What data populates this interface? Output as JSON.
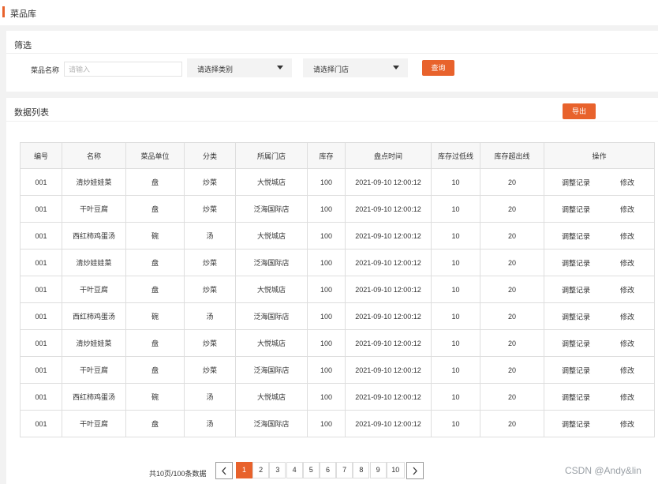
{
  "header": {
    "title": "菜品库"
  },
  "filter": {
    "title": "筛选",
    "name_label": "菜品名称",
    "name_placeholder": "请输入",
    "category_select": "请选择类别",
    "store_select": "请选择门店",
    "query_label": "查询"
  },
  "list": {
    "title": "数据列表",
    "export_label": "导出",
    "columns": [
      "编号",
      "名称",
      "菜品单位",
      "分类",
      "所属门店",
      "库存",
      "盘点时间",
      "库存过低线",
      "库存超出线",
      "操作"
    ],
    "rows": [
      [
        "001",
        "清炒娃娃菜",
        "盘",
        "炒菜",
        "大悦城店",
        "100",
        "2021-09-10 12:00:12",
        "10",
        "20"
      ],
      [
        "001",
        "干叶豆腐",
        "盘",
        "炒菜",
        "泛海国际店",
        "100",
        "2021-09-10 12:00:12",
        "10",
        "20"
      ],
      [
        "001",
        "西红柿鸡蛋汤",
        "碗",
        "汤",
        "大悦城店",
        "100",
        "2021-09-10 12:00:12",
        "10",
        "20"
      ],
      [
        "001",
        "清炒娃娃菜",
        "盘",
        "炒菜",
        "泛海国际店",
        "100",
        "2021-09-10 12:00:12",
        "10",
        "20"
      ],
      [
        "001",
        "干叶豆腐",
        "盘",
        "炒菜",
        "大悦城店",
        "100",
        "2021-09-10 12:00:12",
        "10",
        "20"
      ],
      [
        "001",
        "西红柿鸡蛋汤",
        "碗",
        "汤",
        "泛海国际店",
        "100",
        "2021-09-10 12:00:12",
        "10",
        "20"
      ],
      [
        "001",
        "清炒娃娃菜",
        "盘",
        "炒菜",
        "大悦城店",
        "100",
        "2021-09-10 12:00:12",
        "10",
        "20"
      ],
      [
        "001",
        "干叶豆腐",
        "盘",
        "炒菜",
        "泛海国际店",
        "100",
        "2021-09-10 12:00:12",
        "10",
        "20"
      ],
      [
        "001",
        "西红柿鸡蛋汤",
        "碗",
        "汤",
        "大悦城店",
        "100",
        "2021-09-10 12:00:12",
        "10",
        "20"
      ],
      [
        "001",
        "干叶豆腐",
        "盘",
        "汤",
        "泛海国际店",
        "100",
        "2021-09-10 12:00:12",
        "10",
        "20"
      ]
    ],
    "op_log": "调整记录",
    "op_edit": "修改"
  },
  "pagination": {
    "summary": "共10页/100条数据",
    "pages": [
      "1",
      "2",
      "3",
      "4",
      "5",
      "6",
      "7",
      "8",
      "9",
      "10"
    ],
    "current": "1",
    "prev_icon": "chevron-left-icon",
    "next_icon": "chevron-right-icon"
  },
  "watermark": "CSDN @Andy&lin",
  "colors": {
    "accent": "#e8622c",
    "background": "#f2f2f2",
    "border": "#dedede"
  }
}
